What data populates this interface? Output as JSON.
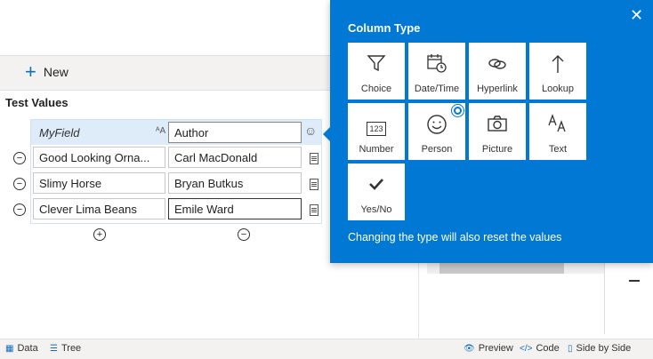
{
  "toolbar": {
    "new_label": "New"
  },
  "section": {
    "title": "Test Values"
  },
  "grid": {
    "header": {
      "field": "MyField",
      "value": "Author"
    },
    "rows": [
      {
        "field": "Good Looking Orna...",
        "value": "Carl MacDonald"
      },
      {
        "field": "Slimy Horse",
        "value": "Bryan Butkus"
      },
      {
        "field": "Clever Lima Beans",
        "value": "Emile Ward"
      }
    ]
  },
  "popup": {
    "title": "Column Type",
    "tiles": [
      {
        "label": "Choice",
        "icon": "funnel-icon"
      },
      {
        "label": "Date/Time",
        "icon": "calendar-clock-icon"
      },
      {
        "label": "Hyperlink",
        "icon": "link-icon"
      },
      {
        "label": "Lookup",
        "icon": "arrow-up-icon"
      },
      {
        "label": "Number",
        "icon": "number-icon",
        "icon_text": "123"
      },
      {
        "label": "Person",
        "icon": "smiley-icon",
        "selected": true
      },
      {
        "label": "Picture",
        "icon": "camera-icon"
      },
      {
        "label": "Text",
        "icon": "text-icon"
      },
      {
        "label": "Yes/No",
        "icon": "checkmark-icon"
      }
    ],
    "note": "Changing the type will also reset the values"
  },
  "statusbar": {
    "data": "Data",
    "tree": "Tree",
    "preview": "Preview",
    "code": "Code",
    "side_by_side": "Side by Side"
  },
  "colors": {
    "accent": "#0078d4",
    "toolbar_bg": "#f3f2f1",
    "header_row_bg": "#deecf9"
  }
}
